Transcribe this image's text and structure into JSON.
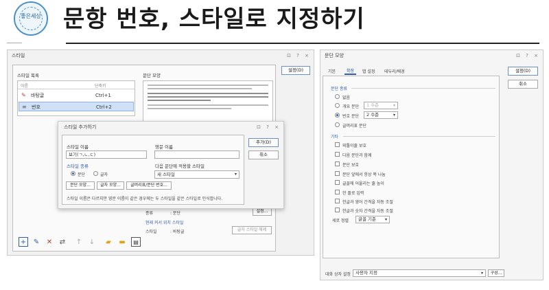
{
  "header": {
    "logo_text": "좋은세상",
    "title": "문항 번호, 스타일로 지정하기"
  },
  "style_window": {
    "title": "스타일",
    "controls": "⊡ ? ×",
    "style_list_label": "스타일 목록",
    "columns": [
      "이름",
      "단축키"
    ],
    "rows": [
      {
        "name": "바탕글",
        "shortcut": "Ctrl+1"
      },
      {
        "name": "번호",
        "shortcut": "Ctrl+2"
      }
    ],
    "preview_label": "문단 모양",
    "set_button": "설정(D)",
    "bottom": {
      "shape_label": "종류",
      "shape_value": ": 문단",
      "edit_button": "설정...",
      "current_label": "현재 커서 위치 스타일",
      "style_label": "스타일",
      "style_value": ": 바탕글",
      "revoke_button": "글자 스타일 해제"
    }
  },
  "add_dialog": {
    "title": "스타일 추가하기",
    "controls": "⊡ ? ×",
    "name_label": "스타일 이름",
    "name_value": "보기(ㄱ,ㄴ,ㄷ)",
    "english_label": "영문 이름",
    "english_value": "",
    "kind_label": "스타일 종류",
    "kind_paragraph": "문단",
    "kind_char": "글자",
    "next_label": "다음 문단에 적용할 스타일",
    "next_value": "새 스타일",
    "btn_para_shape": "문단 모양...",
    "btn_char_shape": "글자 모양...",
    "btn_bullets": "글머리표/문단 번호...",
    "note": "스타일 이름은 다르지만 영문 이름이 같은 경우에는 두 스타일을 같은 스타일로 인식합니다.",
    "add_button": "추가(D)",
    "cancel_button": "취소"
  },
  "para_window": {
    "title": "문단 모양",
    "controls": "⊡ ? ×",
    "tabs": [
      "기본",
      "확장",
      "탭 설정",
      "테두리/배경"
    ],
    "active_tab": "확장",
    "set_button": "설정(D)",
    "cancel_button": "취소",
    "type_section": "문단 종류",
    "types": [
      {
        "label": "없음",
        "selected": false
      },
      {
        "label": "개요 문단",
        "selected": false,
        "select": "1 수준"
      },
      {
        "label": "번호 문단",
        "selected": true,
        "select": "2 수준"
      },
      {
        "label": "글머리표 문단",
        "selected": false
      }
    ],
    "etc_section": "기타",
    "options": [
      "외톨이줄 보호",
      "다음 문단과 함께",
      "문단 보호",
      "문단 앞에서 항상 쪽 나눔",
      "글꼴에 어울리는 줄 높이",
      "한 줄로 입력",
      "한글과 영어 간격을 자동 조절",
      "한글과 숫자 간격을 자동 조절"
    ],
    "vertical_label": "세로 정렬",
    "vertical_value": "글꼴 기준",
    "dialog_setting_label": "대화 상자 설정",
    "dialog_setting_value": "사용자 지정",
    "compose_button": "구성..."
  }
}
